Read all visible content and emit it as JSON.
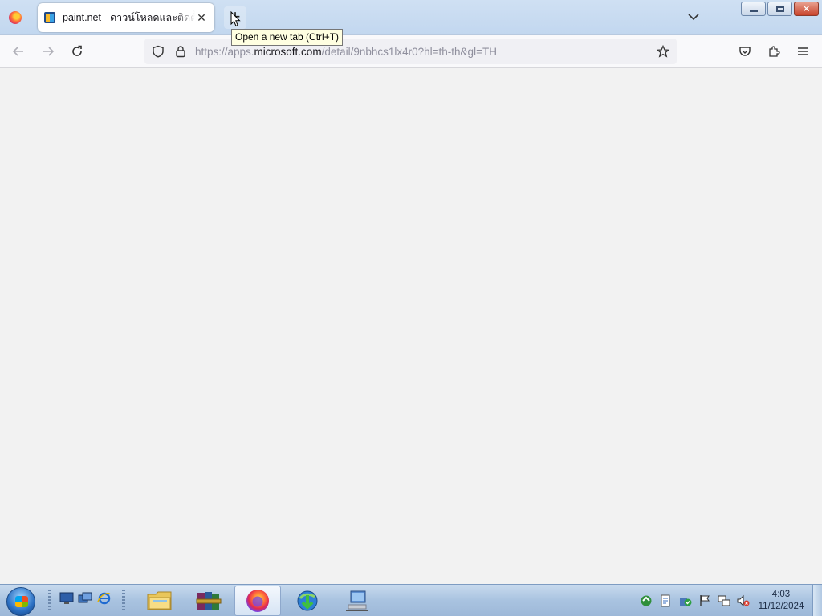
{
  "browser": {
    "tab": {
      "title": "paint.net - ดาวน์โหลดและติดตั้ง",
      "close_glyph": "✕",
      "favicon": "microsoft-store-icon"
    },
    "new_tab": {
      "glyph": "+",
      "tooltip": "Open a new tab (Ctrl+T)"
    },
    "tab_list_icon": "chevron-down-icon",
    "address": {
      "prefix": "https://apps.",
      "host": "microsoft.com",
      "suffix": "/detail/9nbhcs1lx4r0?hl=th-th&gl=TH"
    },
    "nav_icons": [
      "back-arrow-icon",
      "forward-arrow-icon",
      "reload-icon"
    ],
    "toolbar_icons": [
      "pocket-icon",
      "extensions-icon",
      "menu-icon"
    ],
    "urlbar_icons": [
      "tracking-protection-shield-icon",
      "lock-icon",
      "bookmark-star-icon"
    ]
  },
  "window_controls": [
    "minimize",
    "maximize",
    "close"
  ],
  "taskbar": {
    "quick_launch": [
      "show-desktop-icon",
      "switch-windows-icon",
      "internet-explorer-icon"
    ],
    "apps": [
      "file-explorer",
      "winrar",
      "firefox",
      "internet-download-manager",
      "network-computer"
    ],
    "active_app": "firefox",
    "tray_icons": [
      "update-icon",
      "document-icon",
      "security-icon",
      "action-center-flag-icon",
      "network-icon",
      "volume-muted-icon"
    ],
    "clock": {
      "time": "4:03",
      "date": "11/12/2024"
    }
  },
  "colors": {
    "content_bg": "#f2f2f2",
    "tab_bar": "#c5d9f0",
    "taskbar": "#a9c3e0"
  }
}
